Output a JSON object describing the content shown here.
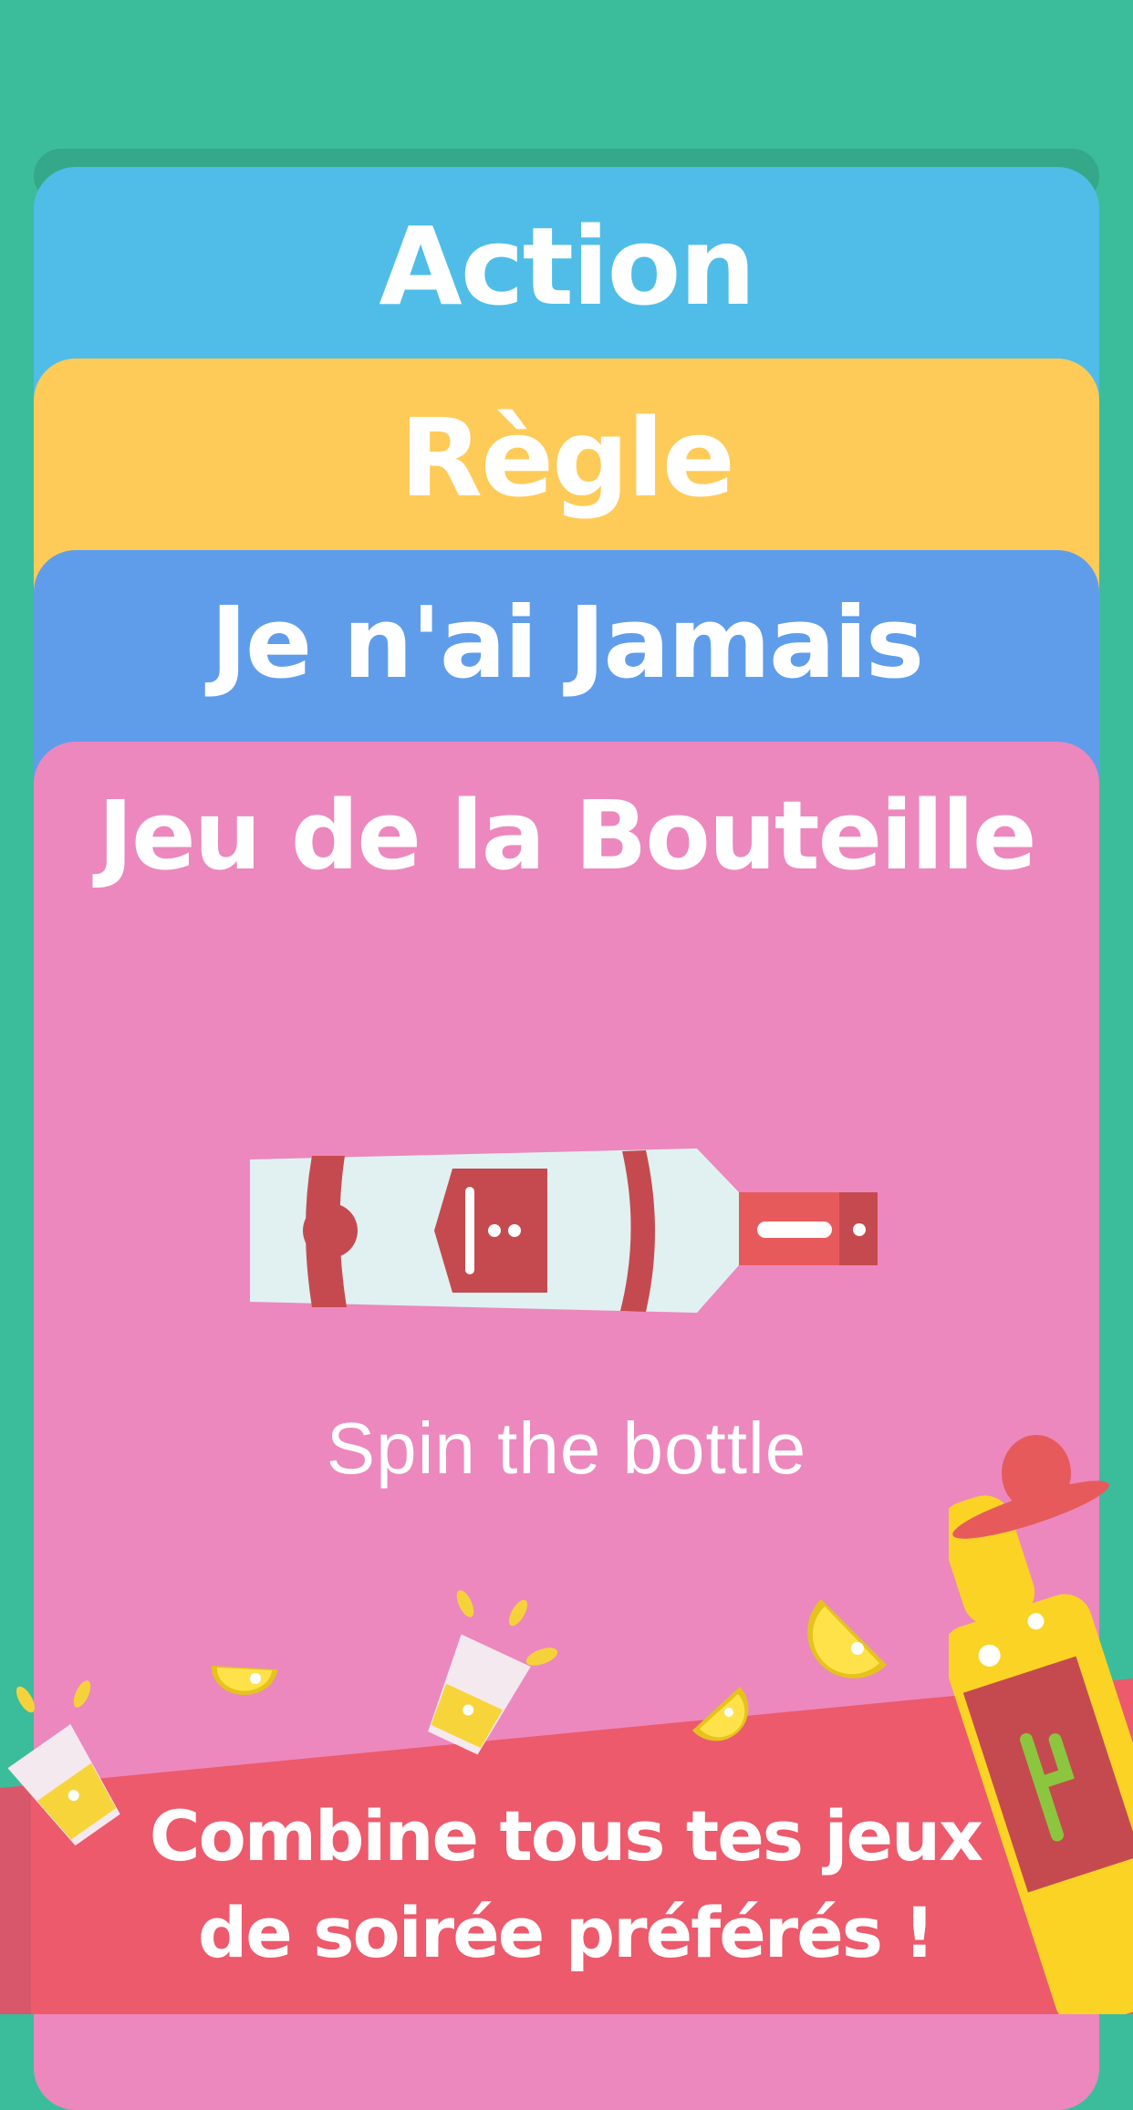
{
  "cards": {
    "action": "Action",
    "regle": "Règle",
    "jamais": "Je n'ai Jamais",
    "bouteille": "Jeu de la Bouteille"
  },
  "bouteille": {
    "subtitle": "Spin the bottle"
  },
  "banner": {
    "line1": "Combine tous tes jeux",
    "line2": "de soirée préférés !"
  },
  "colors": {
    "background": "#3bbd9b",
    "action": "#4fbde8",
    "regle": "#fecb58",
    "jamais": "#5f9deb",
    "bouteille": "#ec88bd",
    "banner": "#ec5a6c"
  },
  "icons": [
    "bottle-icon",
    "lemon-slice-icon",
    "shot-glass-icon",
    "tequila-bottle-icon",
    "sombrero-icon"
  ]
}
